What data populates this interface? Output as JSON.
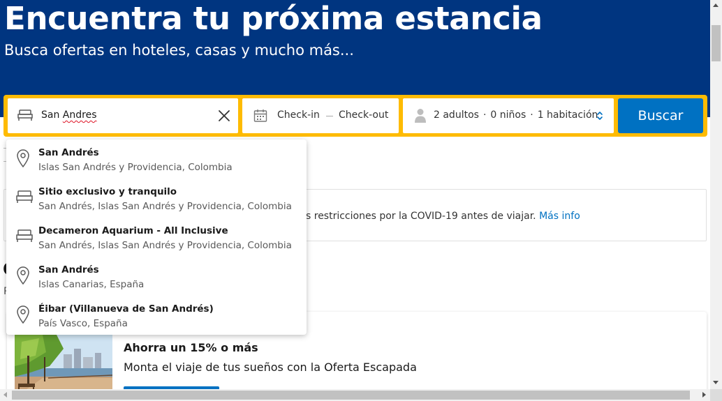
{
  "hero": {
    "title": "Encuentra tu próxima estancia",
    "subtitle": "Busca ofertas en hoteles, casas y mucho más..."
  },
  "search": {
    "destination_prefix": "San ",
    "destination_misspelled": "Andres",
    "checkin_label": "Check-in",
    "checkout_label": "Check-out",
    "adults": "2 adultos",
    "children": "0 niños",
    "rooms": "1 habitación",
    "separator": "·",
    "search_button": "Buscar",
    "icons": {
      "destination": "bed-icon",
      "clear": "close-icon",
      "calendar": "calendar-icon",
      "guests": "person-icon",
      "stepper": "up-down-chevron-icon"
    }
  },
  "suggestions": [
    {
      "icon": "map-pin-icon",
      "name": "San Andrés",
      "location": "Islas San Andrés y Providencia, Colombia"
    },
    {
      "icon": "bed-icon",
      "name": "Sitio exclusivo y tranquilo",
      "location": "San Andrés, Islas San Andrés y Providencia, Colombia"
    },
    {
      "icon": "bed-icon",
      "name": "Decameron Aquarium - All Inclusive",
      "location": "San Andrés, Islas San Andrés y Providencia, Colombia"
    },
    {
      "icon": "map-pin-icon",
      "name": "San Andrés",
      "location": "Islas Canarias, España"
    },
    {
      "icon": "map-pin-icon",
      "name": "Éibar (Villanueva de San Andrés)",
      "location": "País Vasco, España"
    }
  ],
  "covid_notice": {
    "text": "s restricciones por la COVID-19 antes de viajar.",
    "link": "Más info"
  },
  "partial": {
    "heading_char": "O",
    "sub_char": "P"
  },
  "promo": {
    "title": "Ahorra un 15% o más",
    "subtitle": "Monta el viaje de tus sueños con la Oferta Escapada"
  },
  "colors": {
    "brand_blue": "#003580",
    "accent_yellow": "#febb02",
    "button_blue": "#0071c2",
    "link_blue": "#0071c2"
  }
}
